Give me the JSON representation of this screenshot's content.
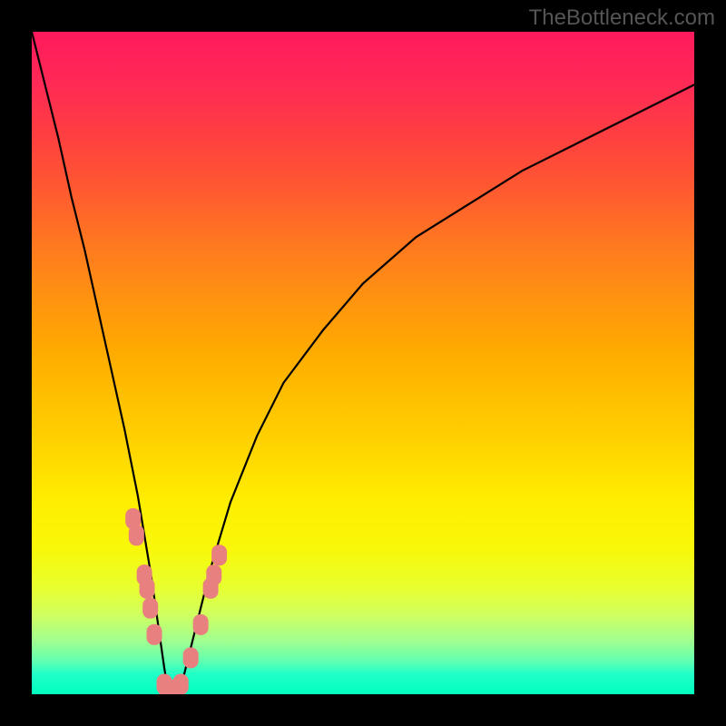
{
  "watermark": "TheBottleneck.com",
  "chart_data": {
    "type": "line",
    "title": "",
    "xlabel": "",
    "ylabel": "",
    "xlim": [
      0,
      100
    ],
    "ylim": [
      0,
      100
    ],
    "series": [
      {
        "name": "curve",
        "x": [
          0,
          2,
          4,
          6,
          8,
          10,
          12,
          14,
          16,
          18,
          19,
          20,
          20.5,
          21,
          22,
          23,
          24,
          25,
          27,
          30,
          34,
          38,
          44,
          50,
          58,
          66,
          74,
          82,
          90,
          100
        ],
        "values": [
          100,
          92,
          84,
          75,
          67,
          58,
          49,
          40,
          30,
          18,
          11,
          4,
          1,
          0,
          1,
          3,
          7,
          11,
          19,
          29,
          39,
          47,
          55,
          62,
          69,
          74,
          79,
          83,
          87,
          92
        ]
      }
    ],
    "markers": [
      {
        "x": 15.3,
        "y": 26.5
      },
      {
        "x": 15.8,
        "y": 24.0
      },
      {
        "x": 17.0,
        "y": 18.0
      },
      {
        "x": 17.4,
        "y": 16.0
      },
      {
        "x": 17.9,
        "y": 13.0
      },
      {
        "x": 18.5,
        "y": 9.0
      },
      {
        "x": 20.0,
        "y": 1.5
      },
      {
        "x": 20.3,
        "y": 1.0
      },
      {
        "x": 21.0,
        "y": 0.5
      },
      {
        "x": 21.7,
        "y": 0.7
      },
      {
        "x": 22.5,
        "y": 1.5
      },
      {
        "x": 24.0,
        "y": 5.5
      },
      {
        "x": 25.5,
        "y": 10.5
      },
      {
        "x": 27.0,
        "y": 16.0
      },
      {
        "x": 27.5,
        "y": 18.0
      },
      {
        "x": 28.3,
        "y": 21.0
      }
    ]
  }
}
